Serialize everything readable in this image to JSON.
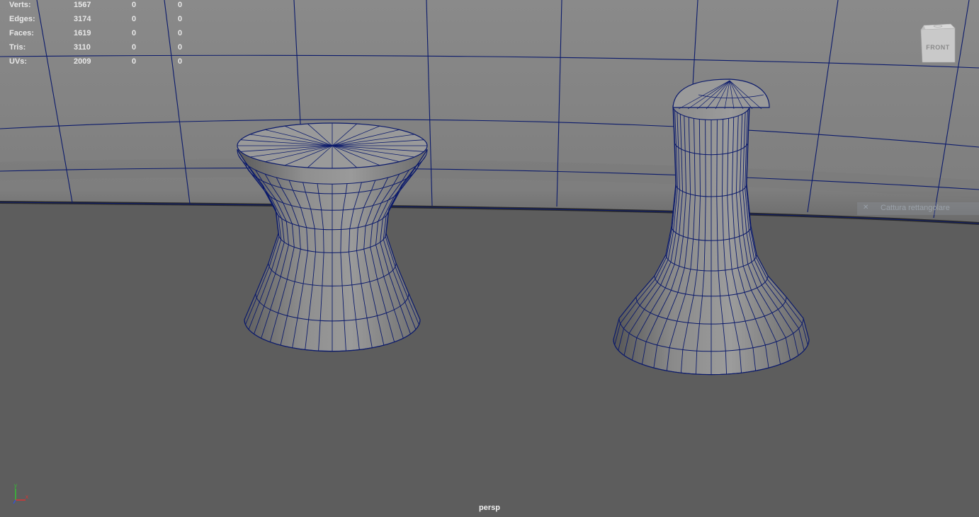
{
  "hud": {
    "rows": [
      {
        "label": "Verts:",
        "total": "1567",
        "sel": "0",
        "comp": "0"
      },
      {
        "label": "Edges:",
        "total": "3174",
        "sel": "0",
        "comp": "0"
      },
      {
        "label": "Faces:",
        "total": "1619",
        "sel": "0",
        "comp": "0"
      },
      {
        "label": "Tris:",
        "total": "3110",
        "sel": "0",
        "comp": "0"
      },
      {
        "label": "UVs:",
        "total": "2009",
        "sel": "0",
        "comp": "0"
      }
    ]
  },
  "viewcube": {
    "face_label": "FRONT"
  },
  "camera": {
    "name": "persp"
  },
  "toast": {
    "text": "Cattura rettangolare",
    "close_icon": "close-icon"
  },
  "axis": {
    "y": "y",
    "x": "x"
  },
  "colors": {
    "wire": "#0b1a6b",
    "floor": "#5d5d5d",
    "wall": "#858585",
    "hud_text": "#e8e8e8"
  }
}
